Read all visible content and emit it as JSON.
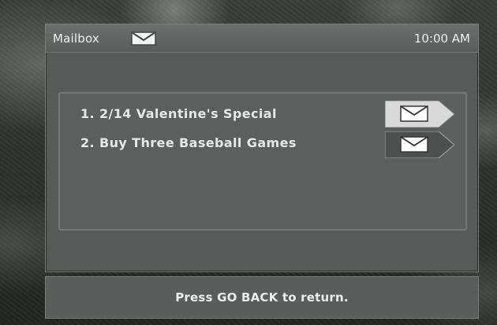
{
  "header": {
    "title": "Mailbox",
    "title_icon": "envelope-icon",
    "time": "10:00 AM"
  },
  "messages": [
    {
      "label": "1. 2/14 Valentine's Special",
      "state": "selected",
      "icon": "envelope-tag-icon"
    },
    {
      "label": "2. Buy Three Baseball Games",
      "state": "normal",
      "icon": "envelope-tag-icon"
    }
  ],
  "footer": {
    "hint": "Press GO BACK to return."
  },
  "colors": {
    "panel": "#585a59",
    "list_bg": "#5d5f5e",
    "text": "#e8e8e8",
    "tag_selected": "#d9d9d9",
    "tag_normal": "#4e504f"
  }
}
